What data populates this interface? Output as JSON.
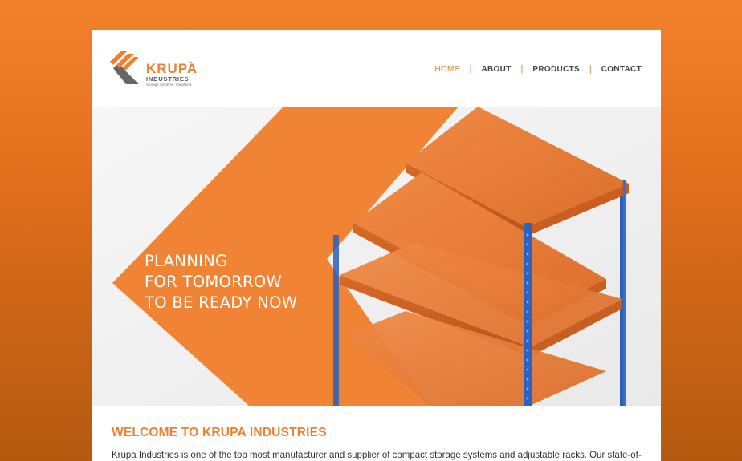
{
  "logo": {
    "name": "KRUPA",
    "tm": "™",
    "subtitle": "INDUSTRIES",
    "tagline": "Storage Systems. Simplified."
  },
  "nav": {
    "items": [
      {
        "label": "HOME"
      },
      {
        "label": "ABOUT"
      },
      {
        "label": "PRODUCTS"
      },
      {
        "label": "CONTACT"
      }
    ],
    "separator": "|"
  },
  "hero": {
    "lines": [
      "PLANNING",
      "FOR TOMORROW",
      "TO BE READY NOW"
    ]
  },
  "welcome": {
    "heading": "WELCOME TO KRUPA INDUSTRIES",
    "intro": "Krupa Industries is one of the top most manufacturer and supplier of compact storage systems and adjustable racks. Our state-of-"
  },
  "colors": {
    "brand_orange": "#f08030",
    "rack_blue": "#2c5fb8",
    "shelf_orange": "#ea7f3a"
  }
}
